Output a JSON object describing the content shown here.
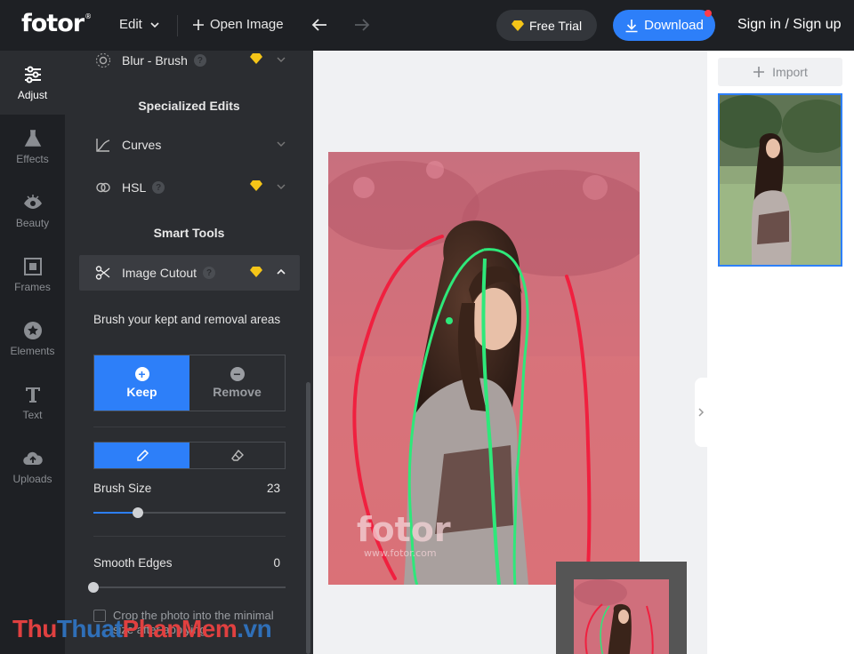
{
  "brand": {
    "logo": "fotor",
    "logo_mark": "®"
  },
  "topbar": {
    "edit_label": "Edit",
    "open_label": "Open Image",
    "trial_label": "Free Trial",
    "download_label": "Download",
    "signin_label": "Sign in / Sign up"
  },
  "rail": [
    {
      "label": "Adjust",
      "icon": "sliders-icon",
      "active": true
    },
    {
      "label": "Effects",
      "icon": "flask-icon"
    },
    {
      "label": "Beauty",
      "icon": "eye-icon"
    },
    {
      "label": "Frames",
      "icon": "frame-icon"
    },
    {
      "label": "Elements",
      "icon": "star-icon"
    },
    {
      "label": "Text",
      "icon": "text-icon"
    },
    {
      "label": "Uploads",
      "icon": "cloud-upload-icon"
    }
  ],
  "panel": {
    "blur_brush": "Blur - Brush",
    "specialized_title": "Specialized Edits",
    "curves": "Curves",
    "hsl": "HSL",
    "smart_tools_title": "Smart Tools",
    "image_cutout": "Image Cutout",
    "brush_desc": "Brush your kept and removal areas",
    "keep_label": "Keep",
    "remove_label": "Remove",
    "brush_size_label": "Brush Size",
    "brush_size_value": "23",
    "brush_size_fraction": 0.23,
    "smooth_edges_label": "Smooth Edges",
    "smooth_edges_value": "0",
    "smooth_edges_fraction": 0,
    "crop_text": "Crop the photo into the minimal size after applying"
  },
  "canvas": {
    "watermark_text": "fotor",
    "watermark_url": "www.fotor.com"
  },
  "right": {
    "import_label": "Import"
  },
  "watermark": {
    "part1": "Thu",
    "part2": "Thuat",
    "part3": "PhanMem",
    "part4": ".vn"
  },
  "colors": {
    "accent": "#2d7ff9",
    "dark": "#1e2024",
    "panel": "#2b2d31",
    "gem": "#f5c518",
    "keep_stroke": "#2ee87a",
    "remove_stroke": "#f0203f"
  }
}
